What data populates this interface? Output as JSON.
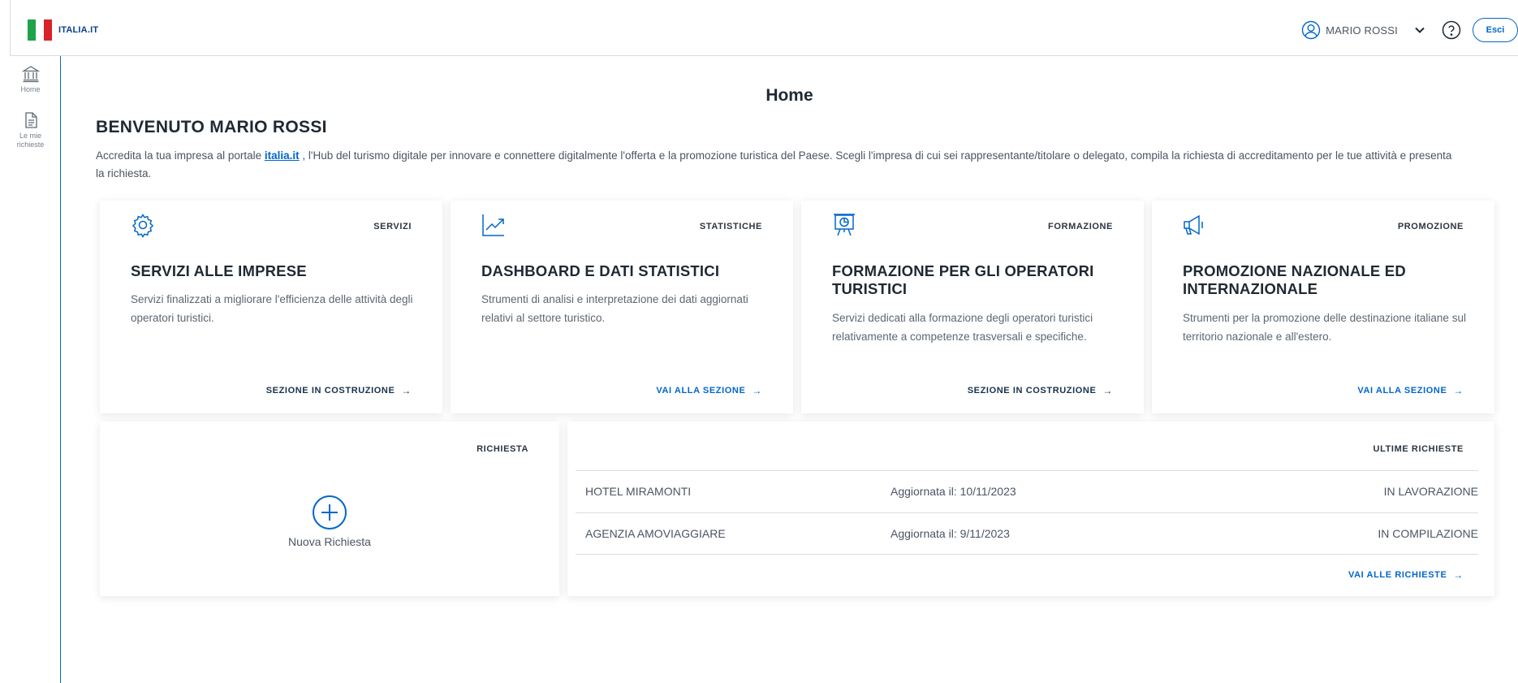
{
  "header": {
    "brand": "ITALIA.IT",
    "user_name": "MARIO ROSSI",
    "logout_label": "Esci",
    "icons": {
      "user": "user-circle-icon",
      "chevron": "chevron-down-icon",
      "help": "help-circle-icon"
    }
  },
  "sidebar": {
    "items": [
      {
        "label": "Home",
        "icon": "bank-icon"
      },
      {
        "label_line1": "Le mie",
        "label_line2": "richieste",
        "icon": "document-icon"
      }
    ]
  },
  "main": {
    "page_title": "Home",
    "welcome": "BENVENUTO MARIO ROSSI",
    "intro_before": "Accredita la tua impresa al portale ",
    "intro_link": "italia.it",
    "intro_after": " , l'Hub del turismo digitale per innovare e connettere digitalmente l'offerta e la promozione turistica del Paese. Scegli l'impresa di cui sei rappresentante/titolare o delegato, compila la richiesta di accreditamento per le tue attività e presenta la richiesta."
  },
  "cards": [
    {
      "tag": "SERVIZI",
      "icon": "gear-icon",
      "title": "SERVIZI ALLE IMPRESE",
      "description": "Servizi finalizzati a migliorare l'efficienza delle attività degli operatori turistici.",
      "link": "SEZIONE IN COSTRUZIONE",
      "link_arrow": "→"
    },
    {
      "tag": "STATISTICHE",
      "icon": "chart-trend-icon",
      "title": "DASHBOARD E DATI STATISTICI",
      "description": "Strumenti di analisi e interpretazione dei dati aggiornati relativi al settore turistico.",
      "link": "VAI ALLA SEZIONE",
      "link_arrow": "→"
    },
    {
      "tag": "FORMAZIONE",
      "icon": "presentation-icon",
      "title": "FORMAZIONE PER GLI OPERATORI TURISTICI",
      "description": "Servizi dedicati alla formazione degli operatori turistici relativamente a competenze trasversali e specifiche.",
      "link": "SEZIONE IN COSTRUZIONE",
      "link_arrow": "→"
    },
    {
      "tag": "PROMOZIONE",
      "icon": "megaphone-icon",
      "title": "PROMOZIONE NAZIONALE ED INTERNAZIONALE",
      "description": "Strumenti per la promozione delle destinazione italiane sul territorio nazionale e all'estero.",
      "link": "VAI ALLA SEZIONE",
      "link_arrow": "→"
    }
  ],
  "request": {
    "tag": "RICHIESTA",
    "new_label": "Nuova Richiesta",
    "icon": "plus-circle-icon"
  },
  "latest": {
    "tag": "ULTIME RICHIESTE",
    "rows": [
      {
        "name": "HOTEL MIRAMONTI",
        "updated": "Aggiornata il: 10/11/2023",
        "status": "IN LAVORAZIONE"
      },
      {
        "name": "AGENZIA AMOVIAGGIARE",
        "updated": "Aggiornata il: 9/11/2023",
        "status": "IN COMPILAZIONE"
      }
    ],
    "link": "VAI ALLE RICHIESTE",
    "link_arrow": "→"
  },
  "colors": {
    "accent": "#0066cc",
    "dark_link": "#17324d",
    "text": "#1f2933",
    "muted": "#5c6773"
  }
}
